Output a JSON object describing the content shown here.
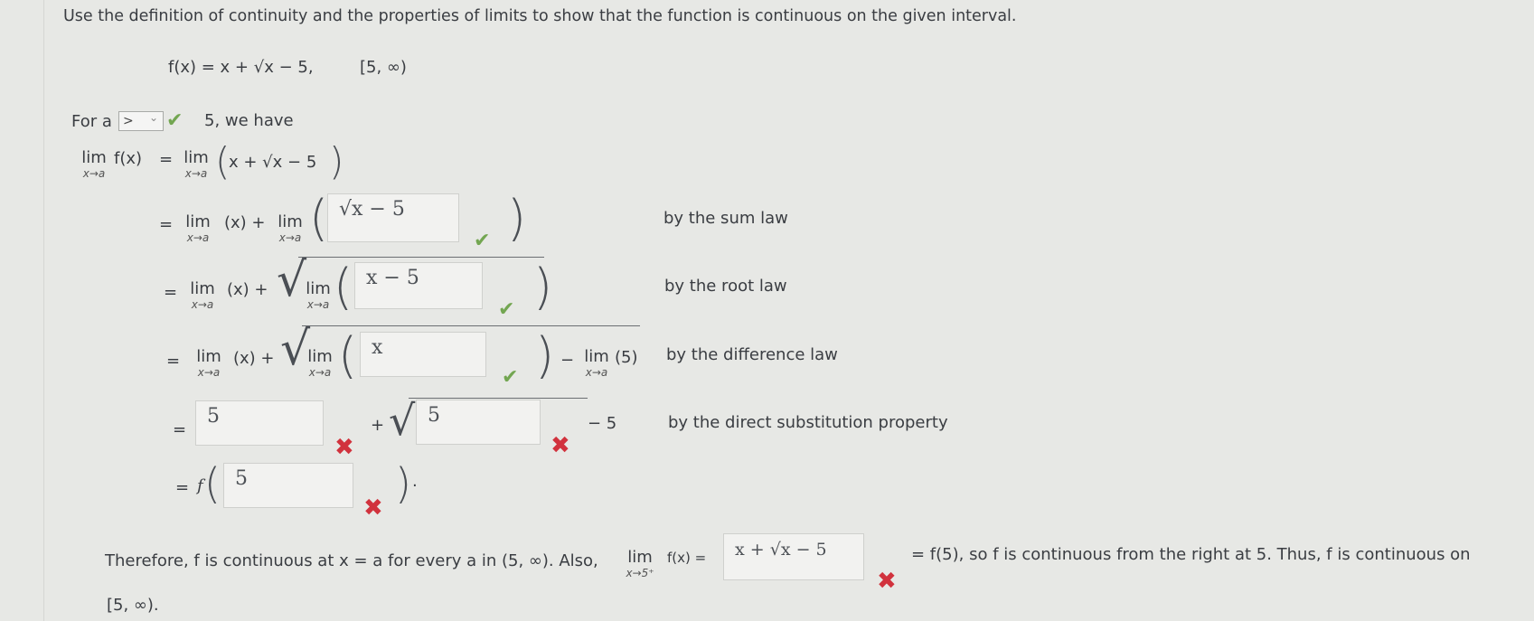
{
  "instruction": "Use the definition of continuity and the properties of limits to show that the function is continuous on the given interval.",
  "function_def": "f(x) = x + √x − 5,",
  "interval": "[5, ∞)",
  "for_a": {
    "prefix": "For a",
    "select_value": ">",
    "select_caret": "⌄",
    "suffix": "5, we have"
  },
  "lim_word": "lim",
  "x_to_a": "x→a",
  "x_to_5plus": "x→5⁺",
  "line1": {
    "lhs_fn": "f(x)",
    "eq": "=",
    "expr": "x + √x − 5"
  },
  "line2": {
    "eq": "=",
    "term1": "(x) +",
    "box": "√x − 5",
    "law": "by the sum law"
  },
  "line3": {
    "eq": "=",
    "term1": "(x) +",
    "box": "x − 5",
    "law": "by the root law"
  },
  "line4": {
    "eq": "=",
    "term1": "(x) +",
    "box": "x",
    "minus": "−",
    "const": "(5)",
    "law": "by the difference law"
  },
  "line5": {
    "eq": "=",
    "box1": "5",
    "plus": "+",
    "box2": "5",
    "minus5": "− 5",
    "law": "by the direct substitution property"
  },
  "line6": {
    "eq": "=",
    "f": "f",
    "box": "5",
    "dot": "."
  },
  "conclusion": {
    "part1": "Therefore, f is continuous at x = a for every a in (5, ∞). Also,",
    "fx_eq": "f(x) =",
    "box": "x + √x − 5",
    "part2": "= f(5), so f is continuous from the right at 5. Thus, f is continuous on",
    "part3": "[5, ∞)."
  },
  "marks": {
    "check": "✔",
    "cross": "✖"
  },
  "colors": {
    "check": "#73a651",
    "cross": "#d1323d",
    "background": "#e7e8e5"
  }
}
